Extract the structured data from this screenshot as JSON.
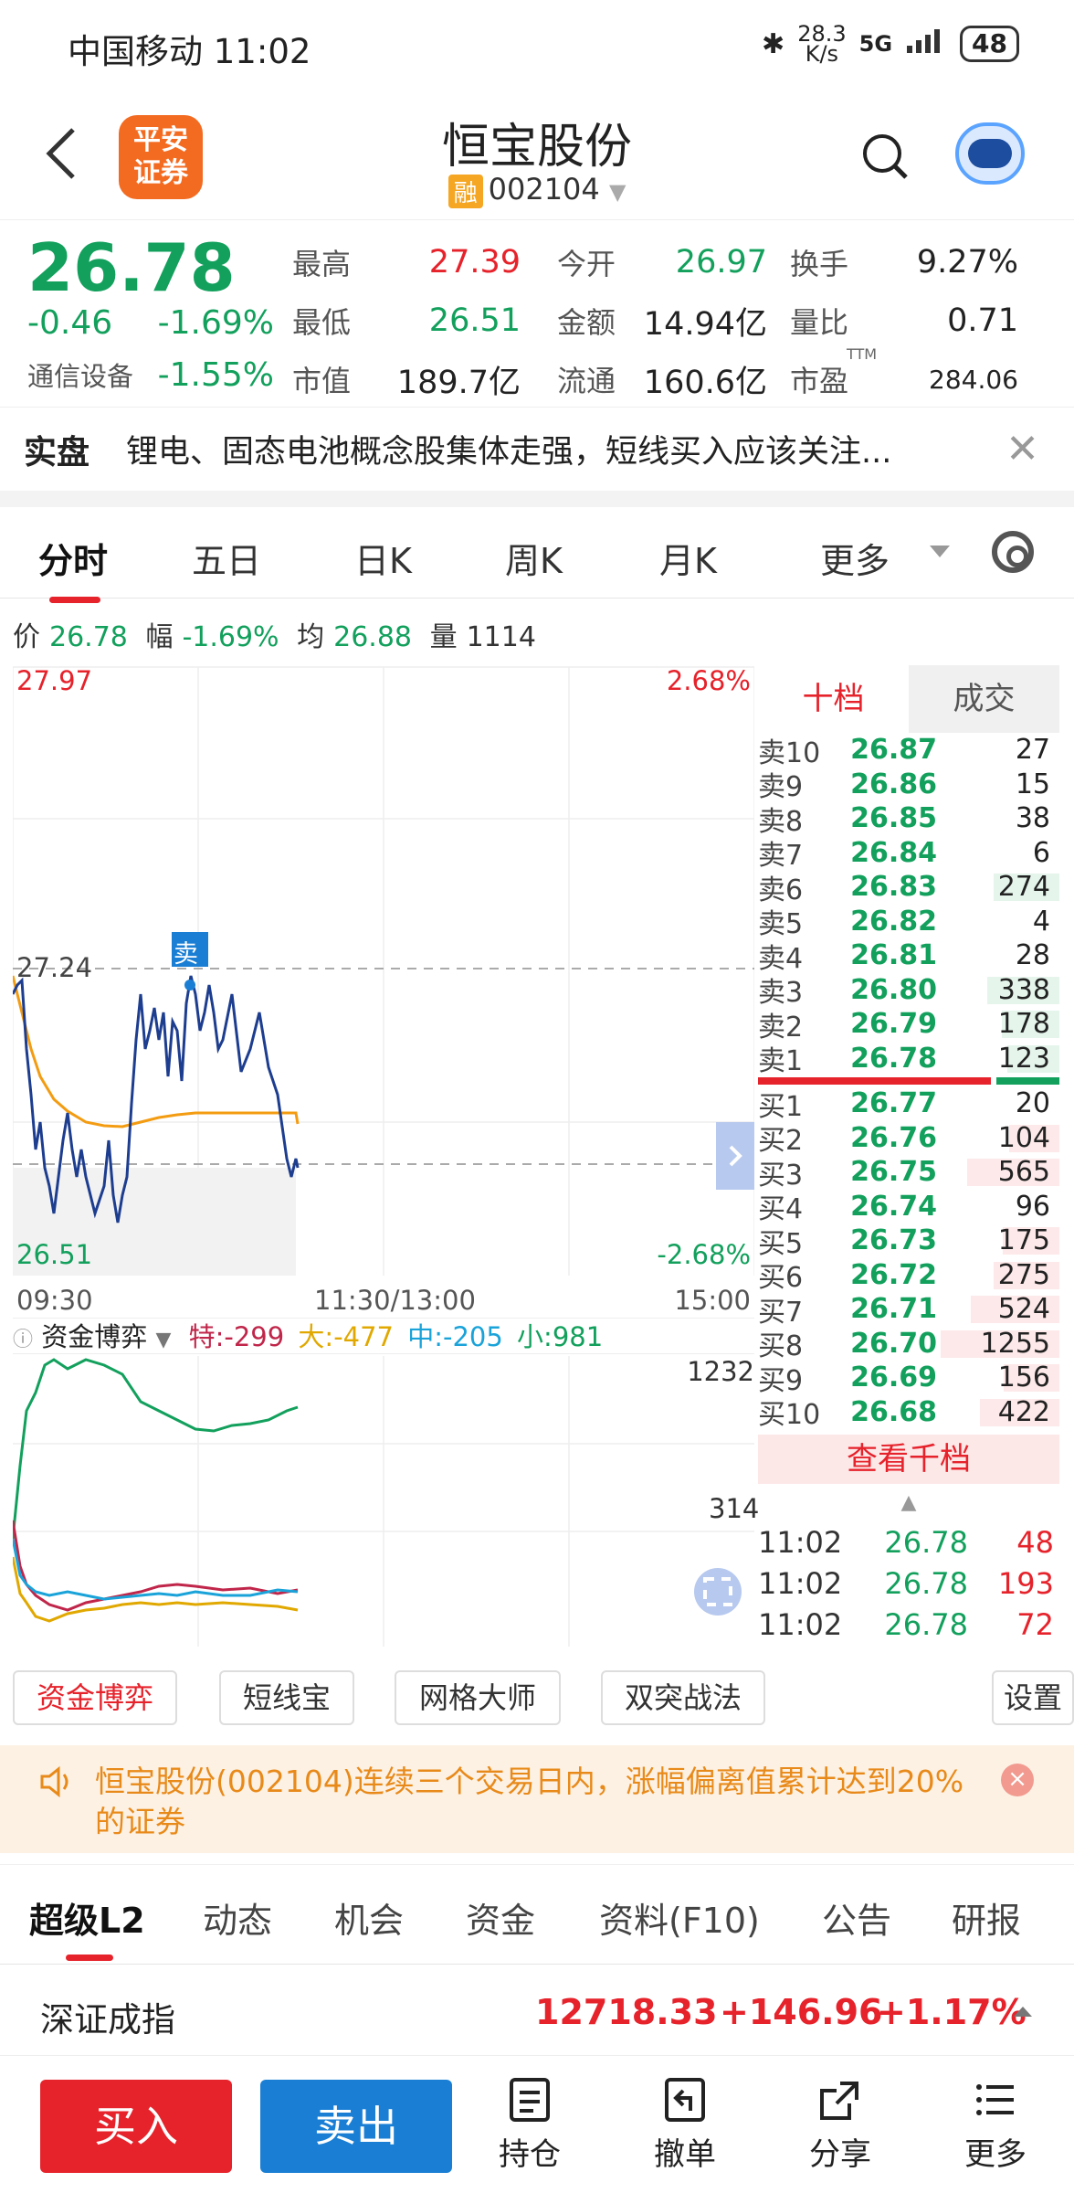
{
  "status": {
    "carrier": "中国移动",
    "time": "11:02",
    "speed_top": "28.3",
    "speed_bottom": "K/s",
    "net": "5G",
    "battery": "48"
  },
  "header": {
    "logo_line1": "平安",
    "logo_line2": "证券",
    "title": "恒宝股份",
    "rong": "融",
    "code": "002104"
  },
  "quote": {
    "price": "26.78",
    "change": "-0.46",
    "change_pct": "-1.69%",
    "sector": "通信设备",
    "sector_pct": "-1.55%",
    "grid": [
      {
        "l1": "最高",
        "v1": "27.39",
        "l2": "今开",
        "v2": "26.97",
        "l3": "换手",
        "v3": "9.27%"
      },
      {
        "l1": "最低",
        "v1": "26.51",
        "l2": "金额",
        "v2": "14.94亿",
        "l3": "量比",
        "v3": "0.71"
      },
      {
        "l1": "市值",
        "v1": "189.7亿",
        "l2": "流通",
        "v2": "160.6亿",
        "l3": "市盈",
        "v3": "284.06",
        "ttm": "TTM"
      }
    ]
  },
  "news": {
    "tag": "实盘",
    "text": "锂电、固态电池概念股集体走强，短线买入应该关注..."
  },
  "ktabs": [
    "分时",
    "五日",
    "日K",
    "周K",
    "月K",
    "更多"
  ],
  "info": {
    "price_label": "价",
    "price": "26.78",
    "amp_label": "幅",
    "amp": "-1.69%",
    "avg_label": "均",
    "avg": "26.88",
    "vol_label": "量",
    "vol": "1114"
  },
  "chart": {
    "top_left": "27.97",
    "top_right": "2.68%",
    "mid_left": "27.24",
    "bottom_left": "26.51",
    "bottom_right": "-2.68%",
    "t_start": "09:30",
    "t_mid": "11:30/13:00",
    "t_end": "15:00",
    "sell_marker": "卖",
    "fund_title": "资金博弈",
    "fund_te": "特:-299",
    "fund_da": "大:-477",
    "fund_zhong": "中:-205",
    "fund_xiao": "小:981",
    "fund_top": "1232",
    "fund_mid": "314"
  },
  "book": {
    "tab_on": "十档",
    "tab_off": "成交",
    "asks": [
      {
        "n": "卖10",
        "p": "26.87",
        "q": "27"
      },
      {
        "n": "卖9",
        "p": "26.86",
        "q": "15"
      },
      {
        "n": "卖8",
        "p": "26.85",
        "q": "38"
      },
      {
        "n": "卖7",
        "p": "26.84",
        "q": "6"
      },
      {
        "n": "卖6",
        "p": "26.83",
        "q": "274"
      },
      {
        "n": "卖5",
        "p": "26.82",
        "q": "4"
      },
      {
        "n": "卖4",
        "p": "26.81",
        "q": "28"
      },
      {
        "n": "卖3",
        "p": "26.80",
        "q": "338"
      },
      {
        "n": "卖2",
        "p": "26.79",
        "q": "178"
      },
      {
        "n": "卖1",
        "p": "26.78",
        "q": "123"
      }
    ],
    "bids": [
      {
        "n": "买1",
        "p": "26.77",
        "q": "20"
      },
      {
        "n": "买2",
        "p": "26.76",
        "q": "104"
      },
      {
        "n": "买3",
        "p": "26.75",
        "q": "565"
      },
      {
        "n": "买4",
        "p": "26.74",
        "q": "96"
      },
      {
        "n": "买5",
        "p": "26.73",
        "q": "175"
      },
      {
        "n": "买6",
        "p": "26.72",
        "q": "275"
      },
      {
        "n": "买7",
        "p": "26.71",
        "q": "524"
      },
      {
        "n": "买8",
        "p": "26.70",
        "q": "1255"
      },
      {
        "n": "买9",
        "p": "26.69",
        "q": "156"
      },
      {
        "n": "买10",
        "p": "26.68",
        "q": "422"
      }
    ],
    "more": "查看千档",
    "trades": [
      {
        "t": "11:02",
        "p": "26.78",
        "v": "48"
      },
      {
        "t": "11:02",
        "p": "26.78",
        "v": "193"
      },
      {
        "t": "11:02",
        "p": "26.78",
        "v": "72"
      }
    ]
  },
  "tools": [
    "资金博弈",
    "短线宝",
    "网格大师",
    "双突战法",
    "设置"
  ],
  "alert": {
    "text": "恒宝股份(002104)连续三个交易日内，涨幅偏离值累计达到20%的证券",
    "close": "×"
  },
  "btabs": [
    "超级L2",
    "动态",
    "机会",
    "资金",
    "资料(F10)",
    "公告",
    "研报"
  ],
  "index": {
    "name": "深证成指",
    "value": "12718.33",
    "change": "+146.96",
    "pct": "+1.17%"
  },
  "actions": {
    "buy": "买入",
    "sell": "卖出",
    "hold": "持仓",
    "cancel": "撤单",
    "share": "分享",
    "more": "更多"
  },
  "colors": {
    "up": "#e6222b",
    "down": "#12a05c",
    "price_line": "#1d3d8f",
    "avg_line": "#f39c12",
    "sell": "#1a7fd4"
  }
}
